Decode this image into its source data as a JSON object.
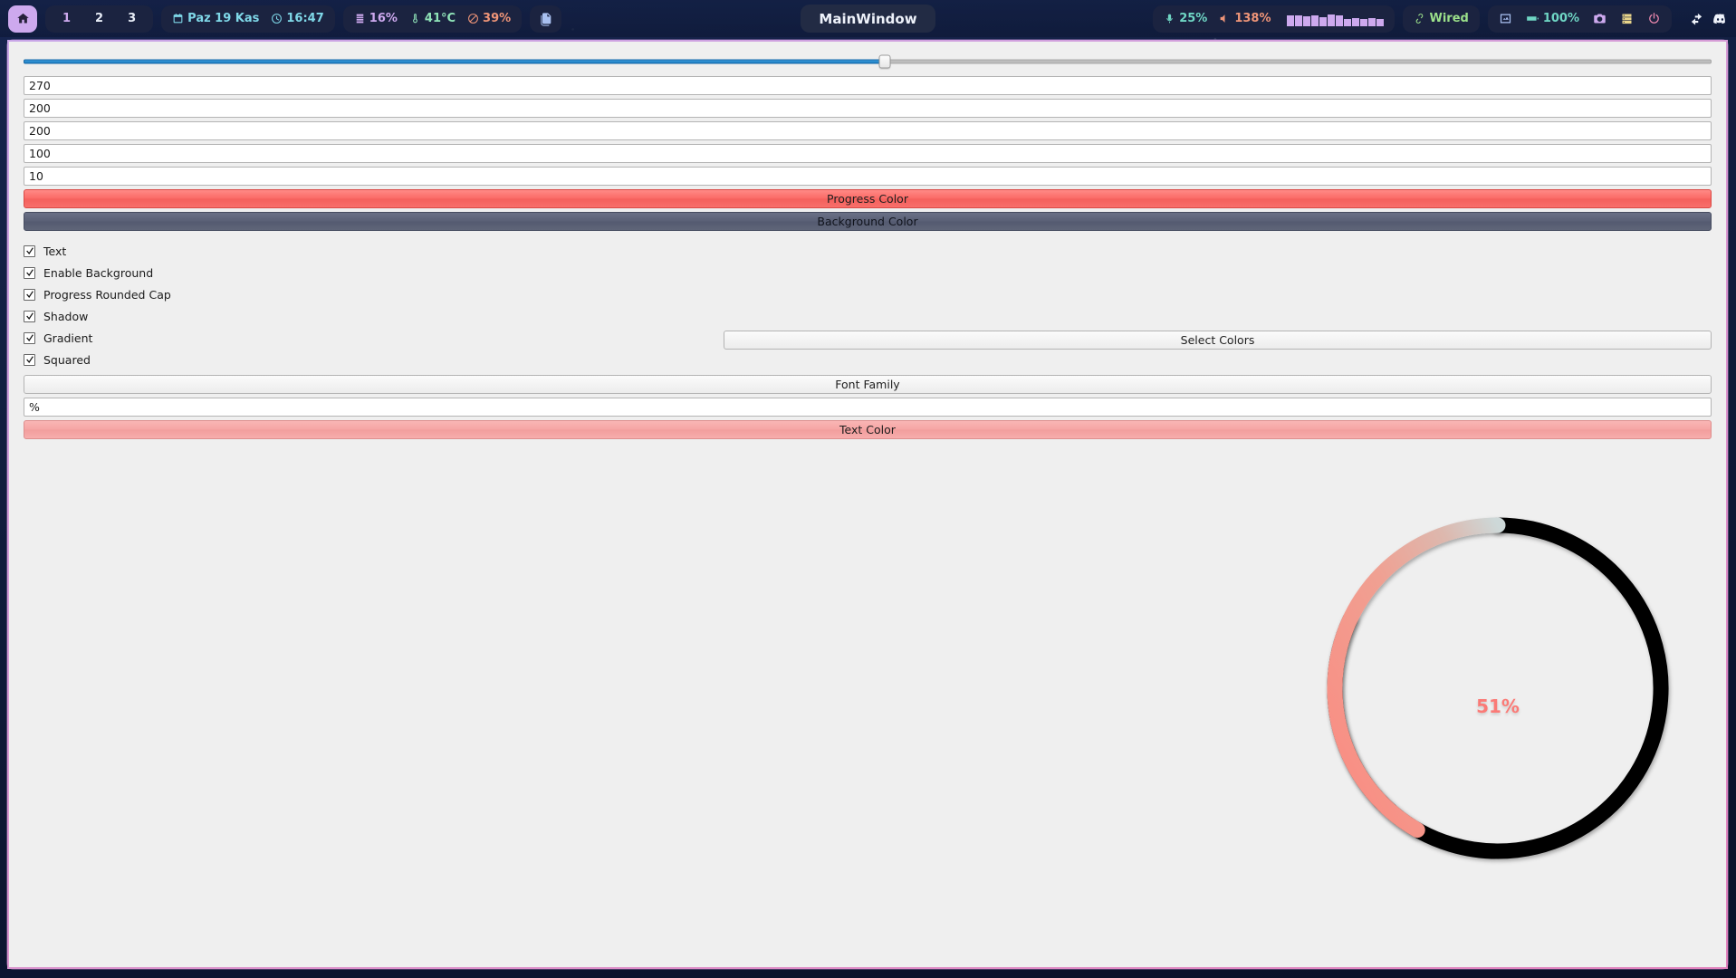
{
  "topbar": {
    "home_button": {
      "icon": "home-icon"
    },
    "workspaces": [
      {
        "label": "1",
        "active": true
      },
      {
        "label": "2",
        "active": false
      },
      {
        "label": "3",
        "active": false
      }
    ],
    "date": {
      "icon": "calendar-icon",
      "text": "Paz 19 Kas"
    },
    "time": {
      "icon": "clock-icon",
      "text": "16:47"
    },
    "ram": {
      "icon": "memory-icon",
      "text": "16%"
    },
    "temp": {
      "icon": "thermometer-icon",
      "text": "41°C"
    },
    "disk": {
      "icon": "disk-icon",
      "text": "39%"
    },
    "files_button": {
      "icon": "file-copy-icon"
    },
    "window_title": "MainWindow",
    "mic": {
      "icon": "microphone-icon",
      "text": "25%"
    },
    "volume": {
      "icon": "speaker-icon",
      "text": "138%"
    },
    "visualizer": {
      "icon": "audio-visualizer",
      "bars": [
        12,
        12,
        11,
        12,
        10,
        13,
        12,
        8,
        9,
        8,
        9,
        8
      ]
    },
    "network": {
      "icon": "ethernet-icon",
      "text": "Wired"
    },
    "tray": [
      {
        "icon": "screenshot-image-icon"
      },
      {
        "icon": "battery-icon",
        "text": "100%"
      },
      {
        "icon": "camera-icon"
      },
      {
        "icon": "server-icon"
      },
      {
        "icon": "power-icon"
      }
    ],
    "corner": [
      {
        "icon": "swap-arrows-icon"
      },
      {
        "icon": "discord-icon"
      }
    ],
    "colors": {
      "accent_purple": "#cda9ee",
      "cyan": "#7fd8e8",
      "green": "#8fe3b8",
      "salmon": "#ef9578",
      "pink": "#f08ab0",
      "yellow": "#e8d48a"
    }
  },
  "window": {
    "slider": {
      "value": 51,
      "min": 0,
      "max": 100
    },
    "fields": [
      {
        "name": "start-angle",
        "value": "270"
      },
      {
        "name": "width",
        "value": "200"
      },
      {
        "name": "height",
        "value": "200"
      },
      {
        "name": "max-value",
        "value": "100"
      },
      {
        "name": "pen-width",
        "value": "10"
      }
    ],
    "buttons": {
      "progress_color": "Progress Color",
      "background_color": "Background Color",
      "select_colors": "Select Colors",
      "font_family": "Font Family",
      "text_color": "Text Color"
    },
    "suffix_field": {
      "value": "%"
    },
    "checkboxes": [
      {
        "label": "Text",
        "checked": true
      },
      {
        "label": "Enable Background",
        "checked": true
      },
      {
        "label": "Progress Rounded Cap",
        "checked": true
      },
      {
        "label": "Shadow",
        "checked": true
      },
      {
        "label": "Gradient",
        "checked": true
      },
      {
        "label": "Squared",
        "checked": true
      }
    ],
    "gauge": {
      "value_text": "51%",
      "percent": 51,
      "start_angle": 270,
      "track_color": "#000000",
      "progress_color_start": "#cdd8d8",
      "progress_color_end": "#f99287",
      "text_color": "#fb7a76"
    },
    "colors": {
      "progress": "#f86f6b",
      "background": "#5a6076",
      "text": "#f6a5a4",
      "surface": "#efefef",
      "slider_fill": "#2e8fd2",
      "border": "#d89ad4"
    }
  }
}
